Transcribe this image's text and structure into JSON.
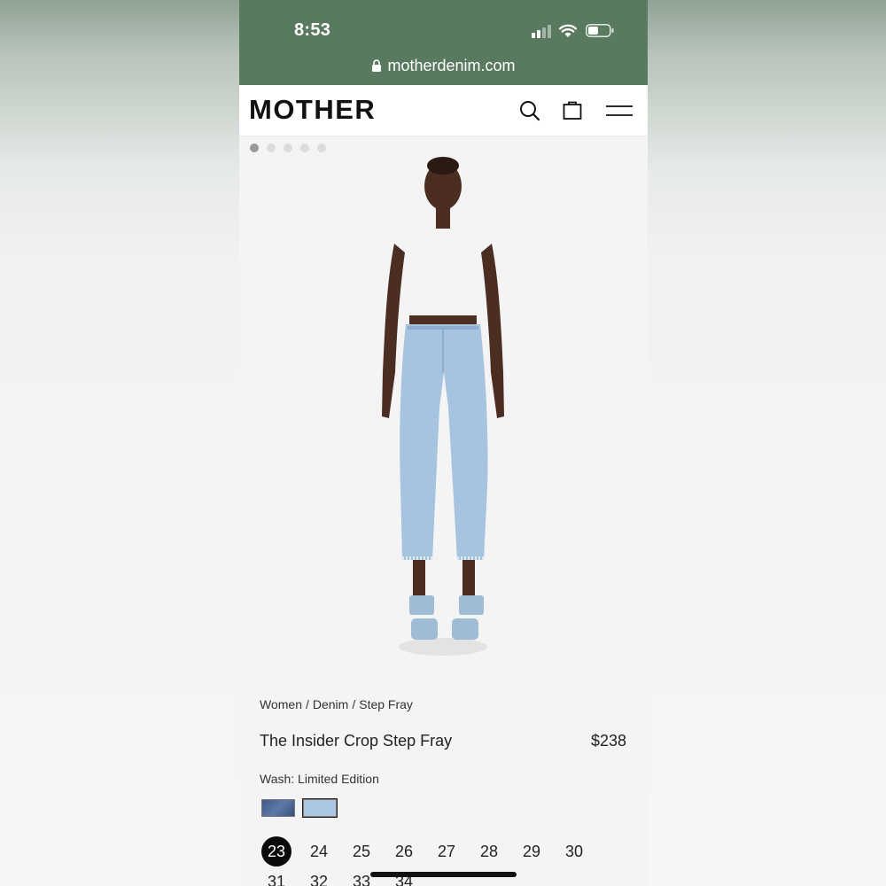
{
  "status_bar": {
    "time": "8:53",
    "url": "motherdenim.com"
  },
  "header": {
    "logo": "MOTHER"
  },
  "carousel": {
    "dot_count": 5,
    "active_index": 0
  },
  "breadcrumb": [
    "Women",
    "Denim",
    "Step Fray"
  ],
  "product": {
    "title": "The Insider Crop Step Fray",
    "price": "$238",
    "wash_label": "Wash: Limited Edition",
    "swatches": [
      {
        "name": "dark-wash",
        "color": "#465f8a"
      },
      {
        "name": "light-wash",
        "color": "#a9c6e2",
        "selected": true
      }
    ]
  },
  "sizes": {
    "row1": [
      "23",
      "24",
      "25",
      "26",
      "27",
      "28",
      "29",
      "30"
    ],
    "row2": [
      "31",
      "32",
      "33",
      "34"
    ],
    "selected": "23"
  },
  "colors": {
    "status_bar": "#5a7a5f",
    "jeans": "#a6c3e0",
    "selected_size": "#0a0a0a"
  }
}
